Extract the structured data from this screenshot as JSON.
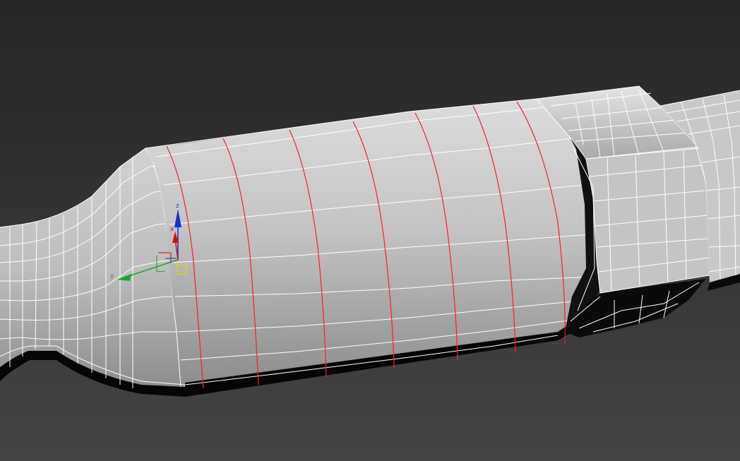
{
  "viewport": {
    "background_top": "#262626",
    "background_bottom": "#444444"
  },
  "mesh": {
    "surface_color": "#c9c9c9",
    "wire_color": "#ffffff",
    "selected_edge_color": "#ff1e1e",
    "underside_color": "#050505"
  },
  "gizmo": {
    "x_label": "x",
    "y_label": "y",
    "z_label": "z",
    "x_color": "#cc1111",
    "y_color": "#11aa22",
    "z_color": "#1133cc",
    "pivot_color": "#e8d200"
  }
}
